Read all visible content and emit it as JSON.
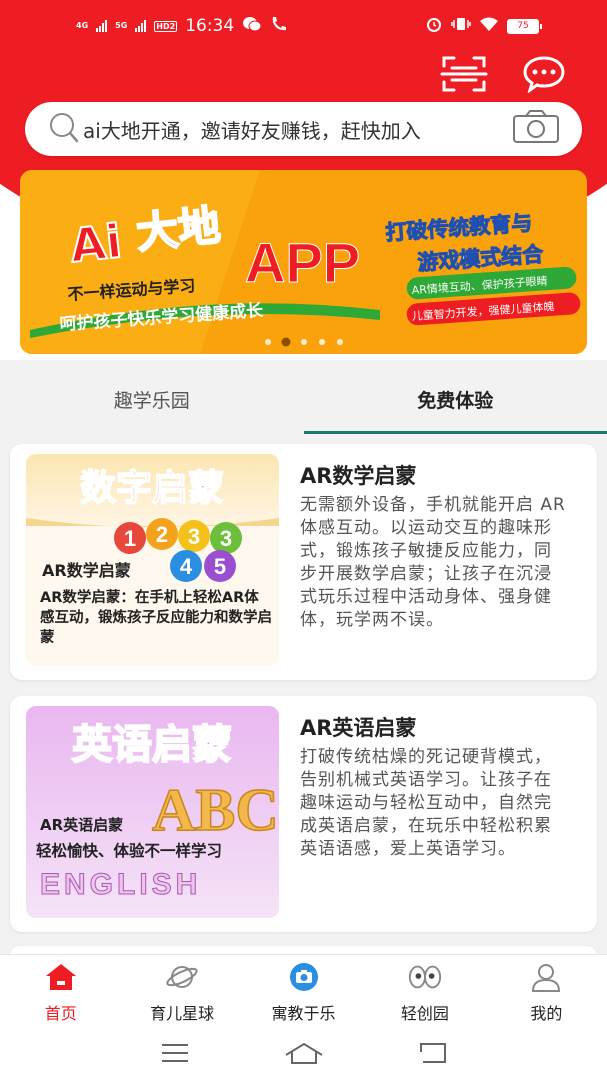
{
  "status_bar": {
    "network_1": "4G",
    "network_2": "5G",
    "hd": "HD2",
    "time": "16:34",
    "battery": "75"
  },
  "search": {
    "placeholder": "ai大地开通，邀请好友赚钱，赶快加入"
  },
  "banner": {
    "title_ai": "Ai",
    "title_cn": "大地",
    "app": "APP",
    "slogan_1": "不一样运动与学习",
    "slogan_2": "呵护孩子快乐学习健康成长",
    "right_title_1": "打破传统教育与",
    "right_title_2": "游戏模式结合",
    "pill_1": "AR情境互动、保护孩子眼睛",
    "pill_2": "儿童智力开发，强健儿童体魄",
    "active_dot": 1,
    "dot_count": 5
  },
  "tabs": [
    {
      "label": "趣学乐园",
      "active": false
    },
    {
      "label": "免费体验",
      "active": true
    }
  ],
  "cards": [
    {
      "title": "AR数学启蒙",
      "desc": "无需额外设备，手机就能开启 AR 体感互动。以运动交互的趣味形式，锻炼孩子敏捷反应能力，同步开展数学启蒙；让孩子在沉浸式玩乐过程中活动身体、强身健体，玩学两不误。",
      "img_header": "数字启蒙",
      "img_title": "AR数学启蒙",
      "img_caption": "AR数学启蒙：在手机上轻松AR体感互动，锻炼孩子反应能力和数学启蒙",
      "img_numbers": [
        "1",
        "2",
        "3",
        "3",
        "4",
        "5"
      ]
    },
    {
      "title": "AR英语启蒙",
      "desc": "打破传统枯燥的死记硬背模式，告别机械式英语学习。让孩子在趣味运动与轻松互动中，自然完成英语启蒙，在玩乐中轻松积累英语语感，爱上英语学习。",
      "img_header": "英语启蒙",
      "img_title": "AR英语启蒙",
      "img_caption": "轻松愉快、体验不一样学习",
      "img_abc": "ABC",
      "img_english": "ENGLISH"
    }
  ],
  "bottom_nav": [
    {
      "label": "首页",
      "icon": "home-icon",
      "active": true
    },
    {
      "label": "育儿星球",
      "icon": "planet-icon",
      "active": false
    },
    {
      "label": "寓教于乐",
      "icon": "camera-icon",
      "active": false
    },
    {
      "label": "轻创园",
      "icon": "eyes-icon",
      "active": false
    },
    {
      "label": "我的",
      "icon": "user-icon",
      "active": false
    }
  ],
  "colors": {
    "brand_red": "#ee1d23",
    "tab_underline": "#1a7a6e",
    "banner_orange": "#f9a20b"
  }
}
